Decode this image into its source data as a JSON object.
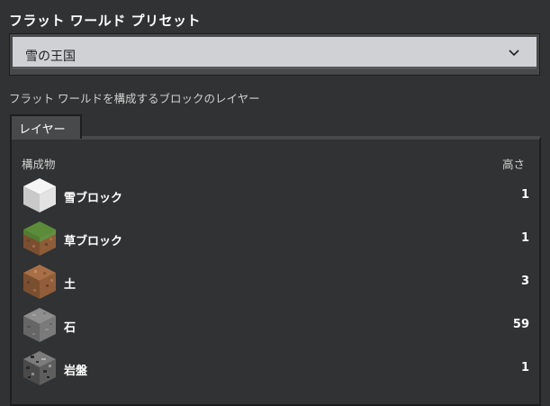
{
  "preset_title": "フラット ワールド プリセット",
  "preset_dropdown": {
    "selected": "雪の王国"
  },
  "layers_description": "フラット ワールドを構成するブロックのレイヤー",
  "tab": {
    "label": "レイヤー"
  },
  "table": {
    "col_composition": "構成物",
    "col_height": "高さ",
    "rows": [
      {
        "name": "雪ブロック",
        "height": "1",
        "icon": "snow-block-icon"
      },
      {
        "name": "草ブロック",
        "height": "1",
        "icon": "grass-block-icon"
      },
      {
        "name": "土",
        "height": "3",
        "icon": "dirt-block-icon"
      },
      {
        "name": "石",
        "height": "59",
        "icon": "stone-block-icon"
      },
      {
        "name": "岩盤",
        "height": "1",
        "icon": "bedrock-block-icon"
      }
    ]
  },
  "colors": {
    "background": "#313233",
    "panel_border": "#1e1e1f",
    "dropdown_face": "#d0d1d4"
  }
}
